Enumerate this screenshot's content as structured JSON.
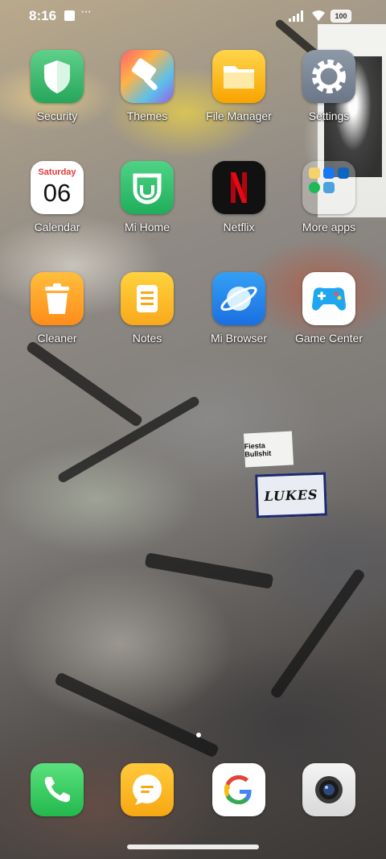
{
  "status_bar": {
    "time": "8:16",
    "notification_dots": "···",
    "battery": "100"
  },
  "apps": {
    "security": "Security",
    "themes": "Themes",
    "file_manager": "File Manager",
    "settings": "Settings",
    "calendar": "Calendar",
    "calendar_day": "Saturday",
    "calendar_date": "06",
    "mi_home": "Mi Home",
    "netflix": "Netflix",
    "more_apps": "More apps",
    "cleaner": "Cleaner",
    "notes": "Notes",
    "mi_browser": "Mi Browser",
    "game_center": "Game Center"
  },
  "wallpaper": {
    "sticker1": "Fiesta Bullshit",
    "sticker2": "LUKES"
  },
  "dock": [
    "phone-icon",
    "messages-icon",
    "google-icon",
    "camera-icon"
  ],
  "colors": {
    "security": "#26a65b",
    "files": "#f7a400",
    "netflix_red": "#e50914",
    "browser": "#1b6fe0",
    "phone": "#22b94d"
  }
}
